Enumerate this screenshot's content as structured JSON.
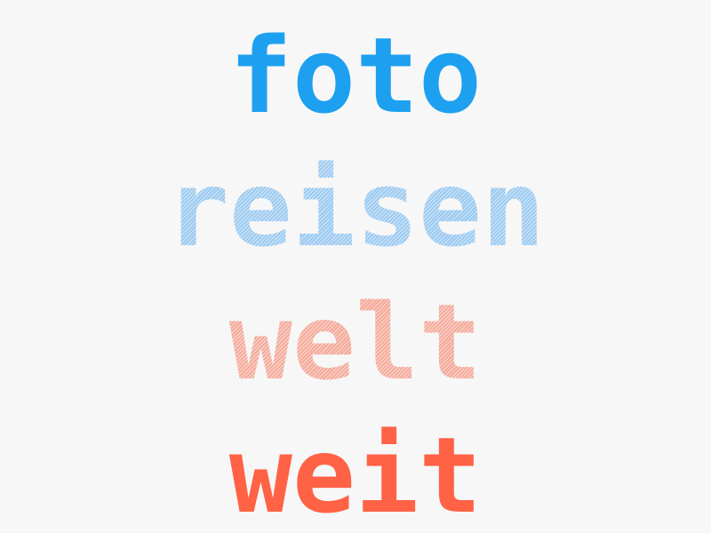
{
  "words": [
    {
      "text": "foto",
      "color": "#1ea0f0",
      "style": "solid"
    },
    {
      "text": "reisen",
      "color": "#9ccaf0",
      "style": "hatched"
    },
    {
      "text": "welt",
      "color": "#f4aa9a",
      "style": "hatched"
    },
    {
      "text": "weit",
      "color": "#ff6244",
      "style": "solid"
    }
  ]
}
